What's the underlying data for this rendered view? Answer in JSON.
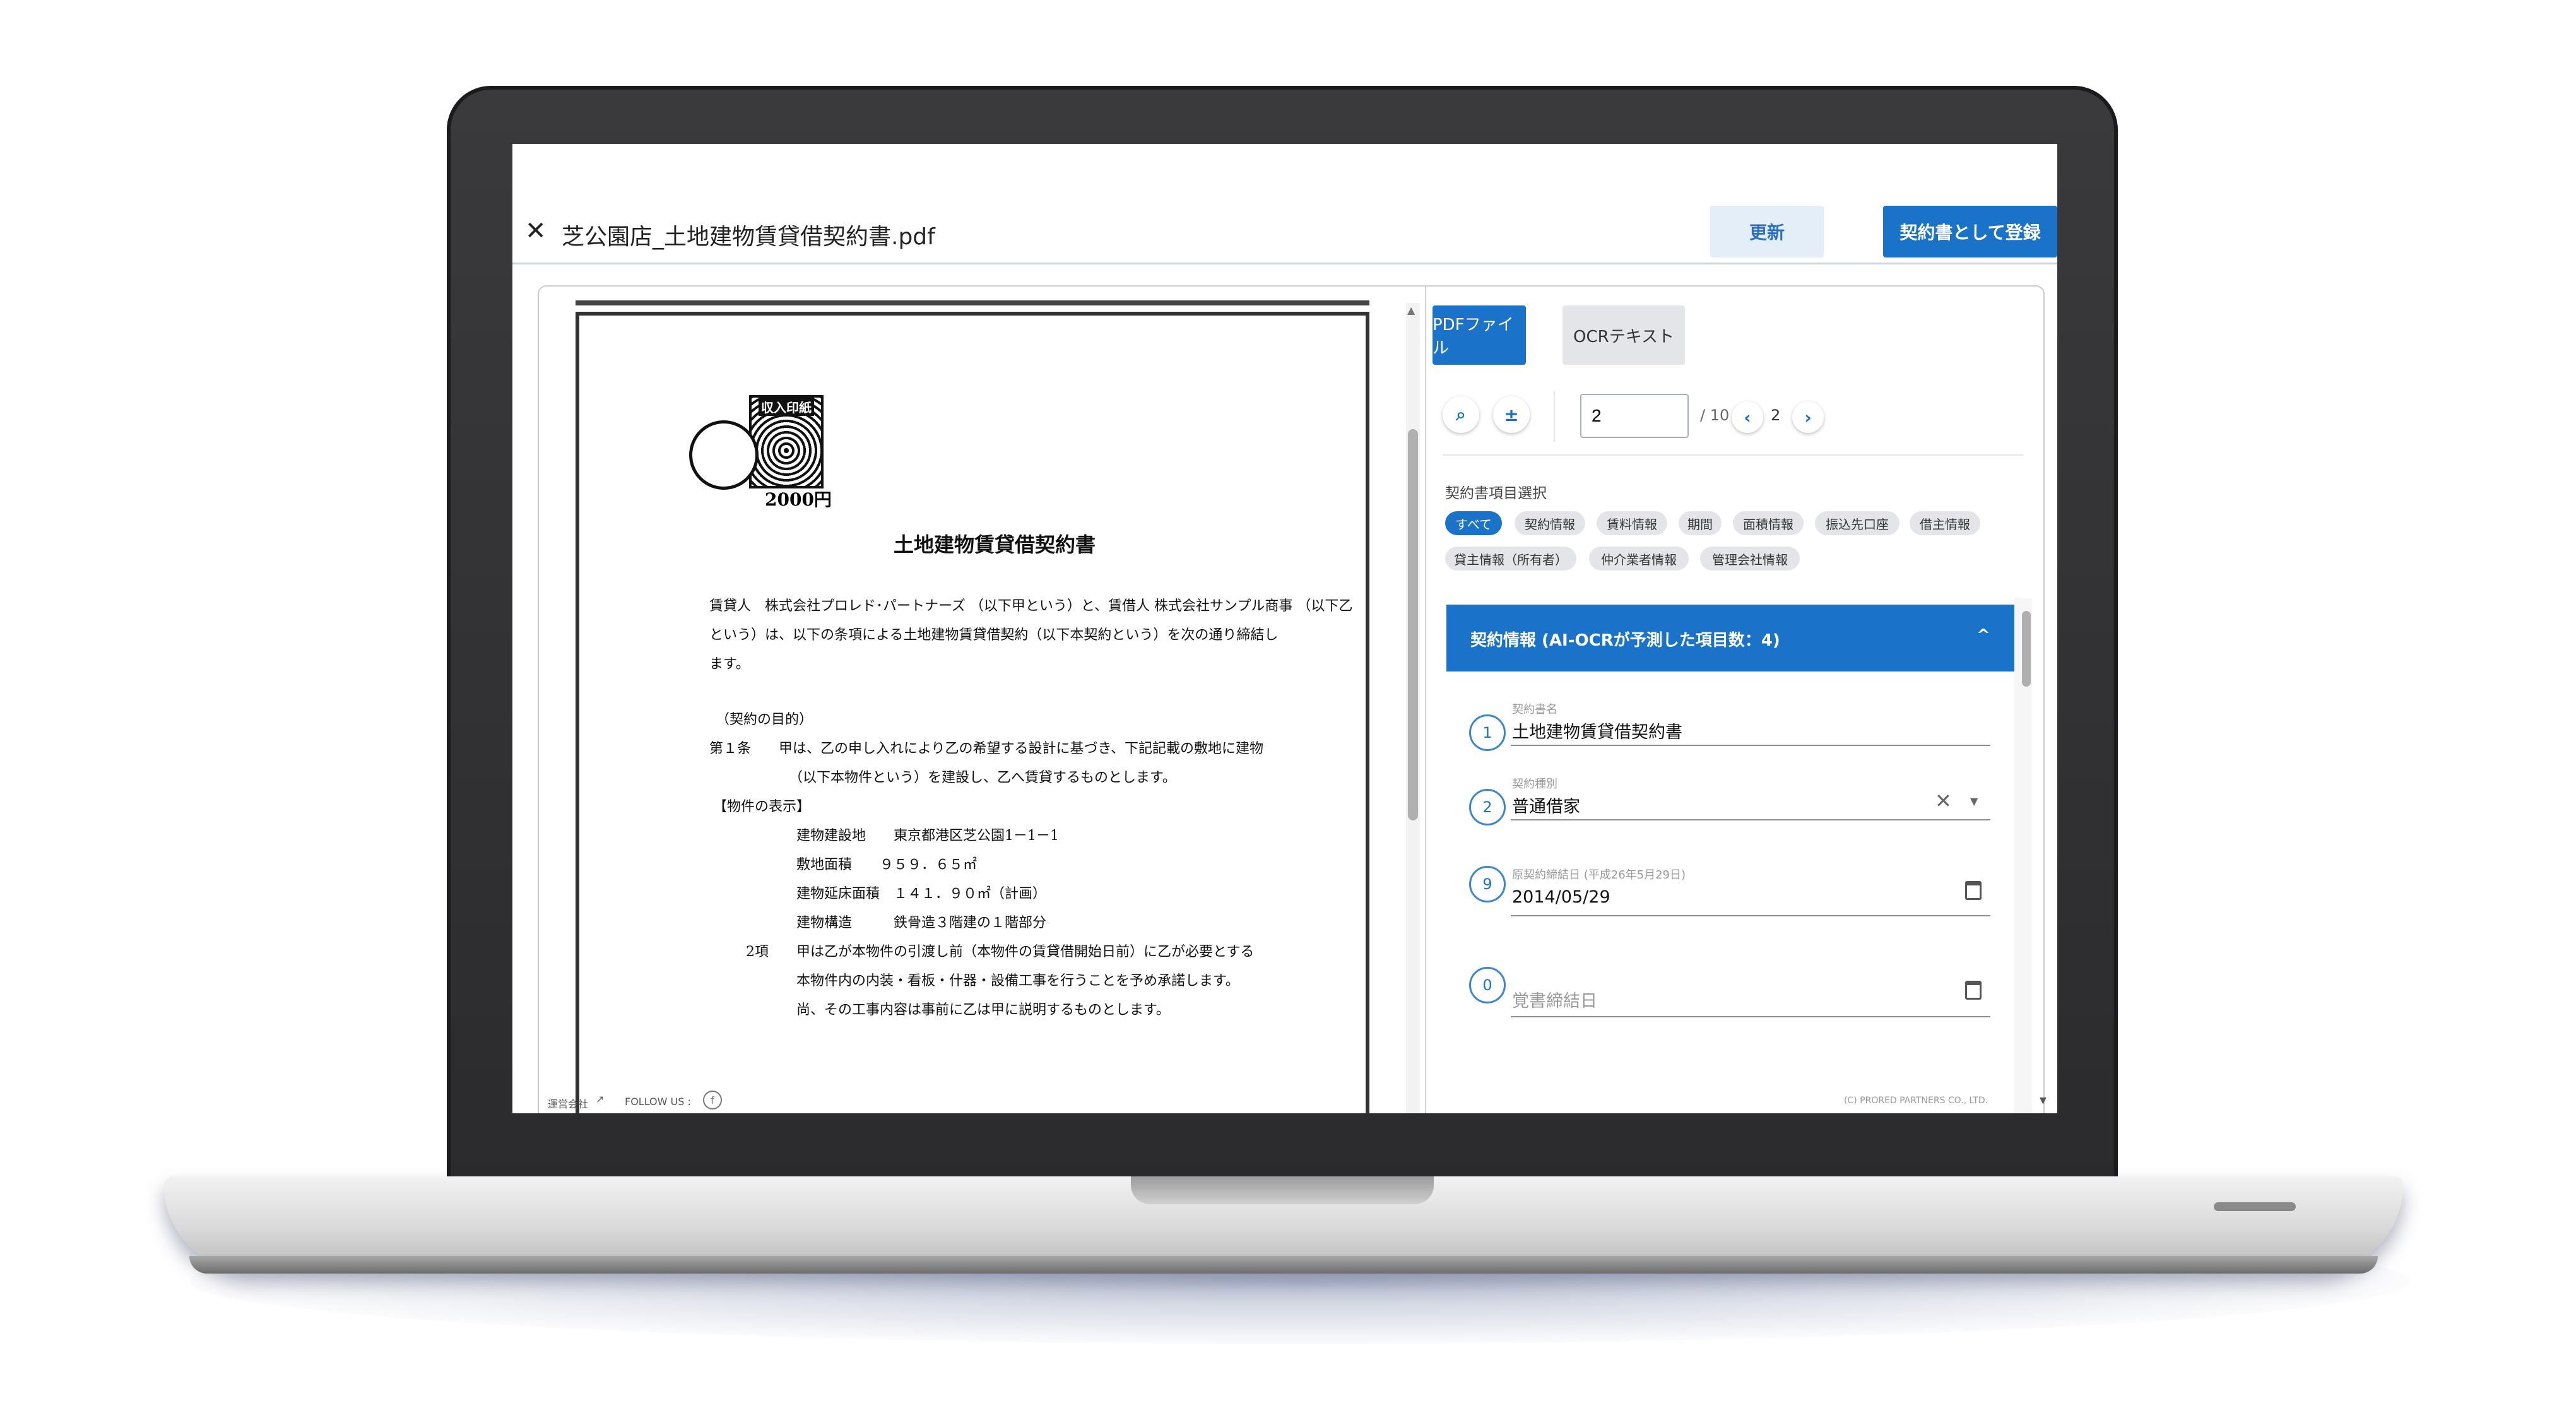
{
  "window": {
    "close_icon": "close-icon",
    "file_title": "芝公園店_土地建物賃貸借契約書.pdf",
    "refresh_label": "更新",
    "register_label": "契約書として登録"
  },
  "document": {
    "stamp_label": "収入印紙",
    "stamp_price": "2000円",
    "title": "土地建物賃貸借契約書",
    "lines": [
      "賃貸人　株式会社プロレド･パートナーズ （以下甲という）と、賃借人 株式会社サンプル商事 （以下乙",
      "という）は、以下の条項による土地建物賃貸借契約（以下本契約という）を次の通り締結し",
      "ます。",
      "（契約の目的）",
      "第１条　　甲は、乙の申し入れにより乙の希望する設計に基づき、下記記載の敷地に建物",
      "（以下本物件という）を建設し、乙へ賃貸するものとします。",
      "【物件の表示】",
      "建物建設地　　東京都港区芝公園1－1－1",
      "敷地面積　　９５９．６５㎡",
      "建物延床面積　１４１．９０㎡（計画）",
      "建物構造　　　鉄骨造３階建の１階部分",
      "2項　　甲は乙が本物件の引渡し前（本物件の賃貸借開始日前）に乙が必要とする",
      "本物件内の内装・看板・什器・設備工事を行うことを予め承諾します。",
      "尚、その工事内容は事前に乙は甲に説明するものとします。"
    ]
  },
  "viewer": {
    "tabs": [
      "PDFファイル",
      "OCRテキスト"
    ],
    "zoom_icon": "zoom-fit-icon",
    "rotate_icon": "plus-minus-icon",
    "page_value": "2",
    "page_total": "/ 10",
    "page_indicator": "2"
  },
  "items": {
    "label": "契約書項目選択",
    "chips": [
      "すべて",
      "契約情報",
      "賃料情報",
      "期間",
      "面積情報",
      "振込先口座",
      "借主情報",
      "貸主情報（所有者）",
      "仲介業者情報",
      "管理会社情報"
    ]
  },
  "section": {
    "title": "契約情報 (AI-OCRが予測した項目数：4)",
    "chevron": "^"
  },
  "fields": [
    {
      "num": "1",
      "label": "契約書名",
      "value": "土地建物賃貸借契約書",
      "placeholder": ""
    },
    {
      "num": "2",
      "label": "契約種別",
      "value": "普通借家",
      "placeholder": ""
    },
    {
      "num": "9",
      "label": "原契約締結日 (平成26年5月29日)",
      "value": "2014/05/29",
      "placeholder": ""
    },
    {
      "num": "0",
      "label": "",
      "value": "",
      "placeholder": "覚書締結日"
    }
  ],
  "footer": {
    "company": "運営会社",
    "follow": "FOLLOW US :",
    "copyright": "(C) PRORED PARTNERS CO., LTD."
  },
  "colors": {
    "accent": "#1a73c8",
    "accent_light": "#e4eef9",
    "chip_bg": "#e3e5e8"
  }
}
